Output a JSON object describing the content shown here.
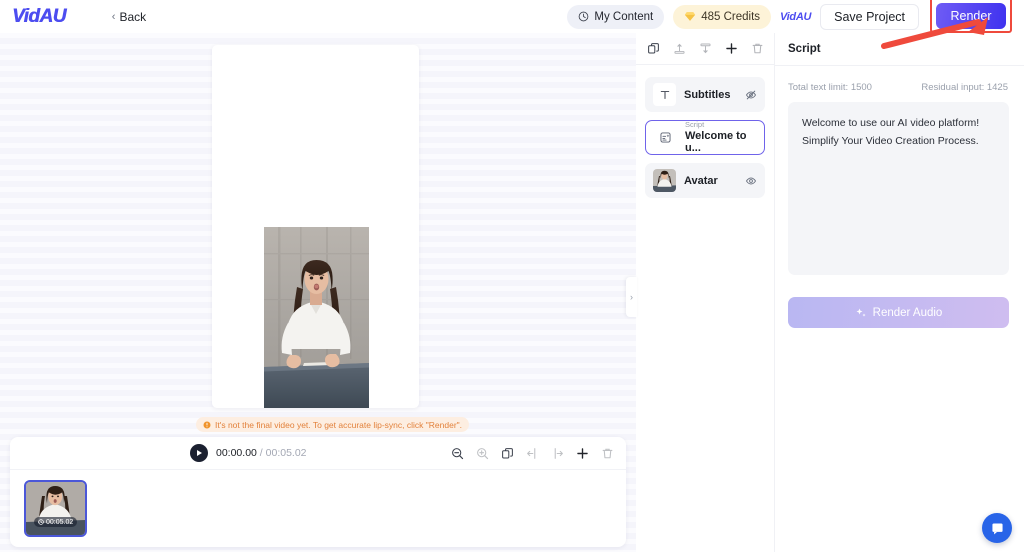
{
  "app": {
    "logo": "VidAU"
  },
  "topbar": {
    "back_label": "Back",
    "my_content_label": "My Content",
    "credits_label": "485 Credits",
    "vidau_mini_label": "VidAU",
    "save_label": "Save Project",
    "render_label": "Render",
    "icons": {
      "back_chevron": "chevron-left-icon",
      "clock": "clock-icon",
      "diamond": "diamond-icon"
    },
    "render_highlight_color": "#ef4a3c",
    "render_accent_color": "#3f32ef"
  },
  "canvas": {
    "warning": "It's not the final video yet. To get accurate lip-sync, click \"Render\".",
    "warning_color": "#e2813b"
  },
  "timeline": {
    "current_time": "00:00.00",
    "separator": "/",
    "total_time": "00:05.02",
    "clip_duration": "00:05.02",
    "tools": [
      {
        "name": "zoom-out-icon",
        "enabled": true
      },
      {
        "name": "zoom-in-icon",
        "enabled": false
      },
      {
        "name": "duplicate-icon",
        "enabled": true
      },
      {
        "name": "split-left-icon",
        "enabled": false
      },
      {
        "name": "split-right-icon",
        "enabled": false
      },
      {
        "name": "add-icon",
        "enabled": true
      },
      {
        "name": "delete-icon",
        "enabled": false
      }
    ]
  },
  "layers": {
    "toolbar": [
      {
        "name": "duplicate-icon",
        "enabled": true
      },
      {
        "name": "bring-to-front-icon",
        "enabled": false
      },
      {
        "name": "send-to-back-icon",
        "enabled": false
      },
      {
        "name": "add-layer-icon",
        "enabled": true
      },
      {
        "name": "delete-layer-icon",
        "enabled": false
      }
    ],
    "items": [
      {
        "title": "Subtitles",
        "subtitle": "",
        "icon": "text-icon",
        "visibility": "hidden",
        "selected": false
      },
      {
        "title": "Welcome to u...",
        "subtitle": "Script",
        "icon": "script-icon",
        "visibility": "",
        "selected": true
      },
      {
        "title": "Avatar",
        "subtitle": "",
        "icon": "avatar-thumb",
        "visibility": "visible",
        "selected": false
      }
    ]
  },
  "script": {
    "panel_title": "Script",
    "total_limit_label": "Total text limit: 1500",
    "residual_label": "Residual input: 1425",
    "text": "Welcome to use our AI video platform! Simplify Your Video Creation Process.",
    "render_audio_label": "Render Audio"
  },
  "chat": {
    "icon": "chat-bubble-icon"
  },
  "collapse": {
    "icon": "chevron-right-icon"
  }
}
